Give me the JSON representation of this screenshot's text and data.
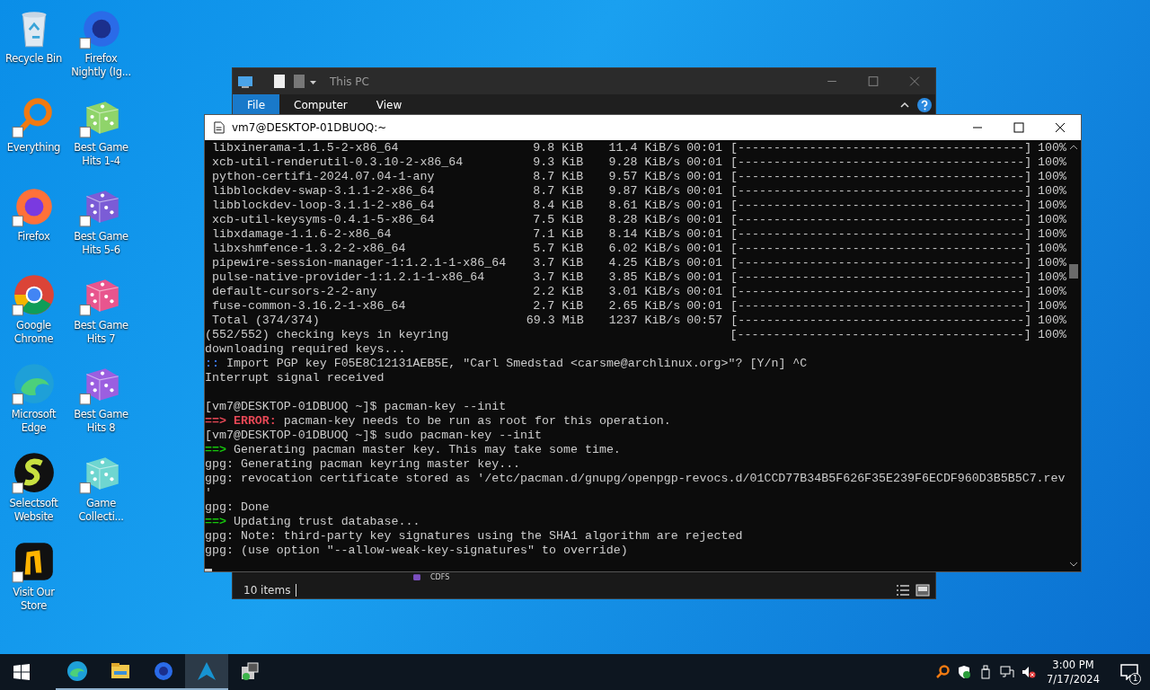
{
  "desktop": {
    "icons": [
      {
        "kind": "recycle",
        "label": "Recycle Bin",
        "shortcut": false
      },
      {
        "kind": "everything",
        "label": "Everything",
        "shortcut": true
      },
      {
        "kind": "firefox",
        "label": "Firefox",
        "shortcut": true
      },
      {
        "kind": "chrome",
        "label": "Google Chrome",
        "shortcut": true
      },
      {
        "kind": "edge",
        "label": "Microsoft Edge",
        "shortcut": true
      },
      {
        "kind": "selectsoft",
        "label": "Selectsoft Website",
        "shortcut": true
      },
      {
        "kind": "store",
        "label": "Visit Our Store",
        "shortcut": true
      },
      {
        "kind": "nightly",
        "label": "Firefox Nightly (Ig...",
        "shortcut": true
      },
      {
        "kind": "dice",
        "label": "Best Game Hits 1-4",
        "color": "#8fd46a",
        "shortcut": true
      },
      {
        "kind": "dice",
        "label": "Best Game Hits 5-6",
        "color": "#7b5cd6",
        "shortcut": true
      },
      {
        "kind": "dice",
        "label": "Best Game Hits 7",
        "color": "#e8558e",
        "shortcut": true
      },
      {
        "kind": "dice",
        "label": "Best Game Hits 8",
        "color": "#9b5fe0",
        "shortcut": true
      },
      {
        "kind": "dice",
        "label": "Game Collecti...",
        "color": "#6fd6d0",
        "shortcut": true
      }
    ]
  },
  "explorer": {
    "title": "This PC",
    "tabs": [
      {
        "label": "File",
        "selected": true
      },
      {
        "label": "Computer",
        "selected": false
      },
      {
        "label": "View",
        "selected": false
      }
    ],
    "partial_item": "CDFS",
    "status": "10 items"
  },
  "terminal": {
    "title": "vm7@DESKTOP-01DBUOQ:~",
    "lines": [
      {
        "kind": "download",
        "name": "libxinerama-1.1.5-2-x86_64",
        "size": "9.8 KiB",
        "rate": "11.4 KiB/s",
        "time": "00:01",
        "bar": "[----------------------------------------]",
        "percent": "100%"
      },
      {
        "kind": "download",
        "name": "xcb-util-renderutil-0.3.10-2-x86_64",
        "size": "9.3 KiB",
        "rate": "9.28 KiB/s",
        "time": "00:01",
        "bar": "[----------------------------------------]",
        "percent": "100%"
      },
      {
        "kind": "download",
        "name": "python-certifi-2024.07.04-1-any",
        "size": "8.7 KiB",
        "rate": "9.57 KiB/s",
        "time": "00:01",
        "bar": "[----------------------------------------]",
        "percent": "100%"
      },
      {
        "kind": "download",
        "name": "libblockdev-swap-3.1.1-2-x86_64",
        "size": "8.7 KiB",
        "rate": "9.87 KiB/s",
        "time": "00:01",
        "bar": "[----------------------------------------]",
        "percent": "100%"
      },
      {
        "kind": "download",
        "name": "libblockdev-loop-3.1.1-2-x86_64",
        "size": "8.4 KiB",
        "rate": "8.61 KiB/s",
        "time": "00:01",
        "bar": "[----------------------------------------]",
        "percent": "100%"
      },
      {
        "kind": "download",
        "name": "xcb-util-keysyms-0.4.1-5-x86_64",
        "size": "7.5 KiB",
        "rate": "8.28 KiB/s",
        "time": "00:01",
        "bar": "[----------------------------------------]",
        "percent": "100%"
      },
      {
        "kind": "download",
        "name": "libxdamage-1.1.6-2-x86_64",
        "size": "7.1 KiB",
        "rate": "8.14 KiB/s",
        "time": "00:01",
        "bar": "[----------------------------------------]",
        "percent": "100%"
      },
      {
        "kind": "download",
        "name": "libxshmfence-1.3.2-2-x86_64",
        "size": "5.7 KiB",
        "rate": "6.02 KiB/s",
        "time": "00:01",
        "bar": "[----------------------------------------]",
        "percent": "100%"
      },
      {
        "kind": "download",
        "name": "pipewire-session-manager-1:1.2.1-1-x86_64",
        "size": "3.7 KiB",
        "rate": "4.25 KiB/s",
        "time": "00:01",
        "bar": "[----------------------------------------]",
        "percent": "100%"
      },
      {
        "kind": "download",
        "name": "pulse-native-provider-1:1.2.1-1-x86_64",
        "size": "3.7 KiB",
        "rate": "3.85 KiB/s",
        "time": "00:01",
        "bar": "[----------------------------------------]",
        "percent": "100%"
      },
      {
        "kind": "download",
        "name": "default-cursors-2-2-any",
        "size": "2.2 KiB",
        "rate": "3.01 KiB/s",
        "time": "00:01",
        "bar": "[----------------------------------------]",
        "percent": "100%"
      },
      {
        "kind": "download",
        "name": "fuse-common-3.16.2-1-x86_64",
        "size": "2.7 KiB",
        "rate": "2.65 KiB/s",
        "time": "00:01",
        "bar": "[----------------------------------------]",
        "percent": "100%"
      },
      {
        "kind": "download",
        "name": "Total (374/374)",
        "size": "69.3 MiB",
        "rate": "1237 KiB/s",
        "time": "00:57",
        "bar": "[----------------------------------------]",
        "percent": "100%"
      },
      {
        "kind": "keys",
        "text": "(552/552) checking keys in keyring",
        "bar": "[----------------------------------------]",
        "percent": "100%"
      },
      {
        "kind": "plain",
        "text": "downloading required keys..."
      },
      {
        "kind": "marker",
        "prefix": "::",
        "color": "#3b78ff",
        "text": "Import PGP key F05E8C12131AEB5E, \"Carl Smedstad <carsme@archlinux.org>\"? [Y/n] ^C"
      },
      {
        "kind": "plain",
        "text": "Interrupt signal received"
      },
      {
        "kind": "blank"
      },
      {
        "kind": "plain",
        "text": "[vm7@DESKTOP-01DBUOQ ~]$ pacman-key --init"
      },
      {
        "kind": "marker",
        "prefix": "==> ERROR:",
        "color": "#e74856",
        "text": "pacman-key needs to be run as root for this operation."
      },
      {
        "kind": "plain",
        "text": "[vm7@DESKTOP-01DBUOQ ~]$ sudo pacman-key --init"
      },
      {
        "kind": "marker",
        "prefix": "==>",
        "color": "#16c60c",
        "text": "Generating pacman master key. This may take some time."
      },
      {
        "kind": "plain",
        "text": "gpg: Generating pacman keyring master key..."
      },
      {
        "kind": "plain",
        "text": "gpg: revocation certificate stored as '/etc/pacman.d/gnupg/openpgp-revocs.d/01CCD77B34B5F626F35E239F6ECDF960D3B5B5C7.rev"
      },
      {
        "kind": "plain",
        "text": "'"
      },
      {
        "kind": "plain",
        "text": "gpg: Done"
      },
      {
        "kind": "marker",
        "prefix": "==>",
        "color": "#16c60c",
        "text": "Updating trust database..."
      },
      {
        "kind": "plain",
        "text": "gpg: Note: third-party key signatures using the SHA1 algorithm are rejected"
      },
      {
        "kind": "plain",
        "text": "gpg: (use option \"--allow-weak-key-signatures\" to override)"
      },
      {
        "kind": "cursor"
      }
    ]
  },
  "taskbar": {
    "apps": [
      {
        "kind": "edge",
        "running": true,
        "selected": false
      },
      {
        "kind": "explorer",
        "running": true,
        "selected": false
      },
      {
        "kind": "firefox",
        "running": true,
        "selected": false
      },
      {
        "kind": "arch",
        "running": true,
        "selected": true
      },
      {
        "kind": "installer",
        "running": false,
        "selected": false
      }
    ],
    "time": "3:00 PM",
    "date": "7/17/2024",
    "notifications": "1"
  }
}
